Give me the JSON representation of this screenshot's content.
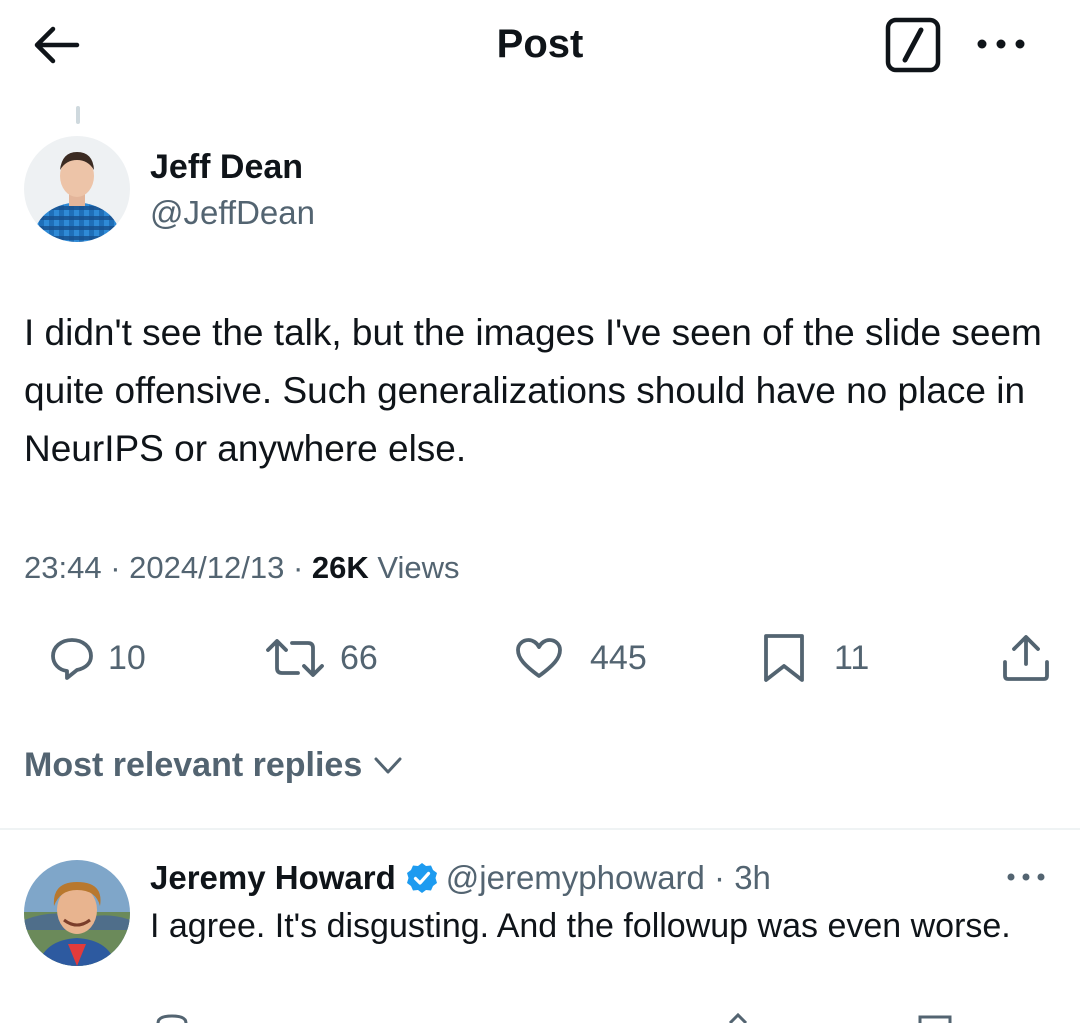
{
  "header": {
    "title": "Post",
    "back_icon": "arrow-left-icon",
    "compose_icon": "compose-icon",
    "more_icon": "more-horizontal-icon"
  },
  "post": {
    "author_name": "Jeff Dean",
    "author_handle": "@JeffDean",
    "text": "I didn't see the talk, but the images I've seen of the slide seem quite offensive.  Such generalizations should have no place in NeurIPS or anywhere else.",
    "time": "23:44",
    "separator": "·",
    "date": "2024/12/13",
    "views_count": "26K",
    "views_label": "Views"
  },
  "actions": {
    "replies": "10",
    "reposts": "66",
    "likes": "445",
    "bookmarks": "11"
  },
  "replies_section": {
    "sort_label": "Most relevant replies"
  },
  "reply": {
    "author_name": "Jeremy Howard",
    "author_handle": "@jeremyphoward · 3h",
    "text": "I agree. It's disgusting. And the followup was even worse.",
    "verified_color": "#1d9bf0"
  },
  "colors": {
    "text_primary": "#0f1419",
    "text_secondary": "#536471",
    "divider": "#eff3f4"
  }
}
